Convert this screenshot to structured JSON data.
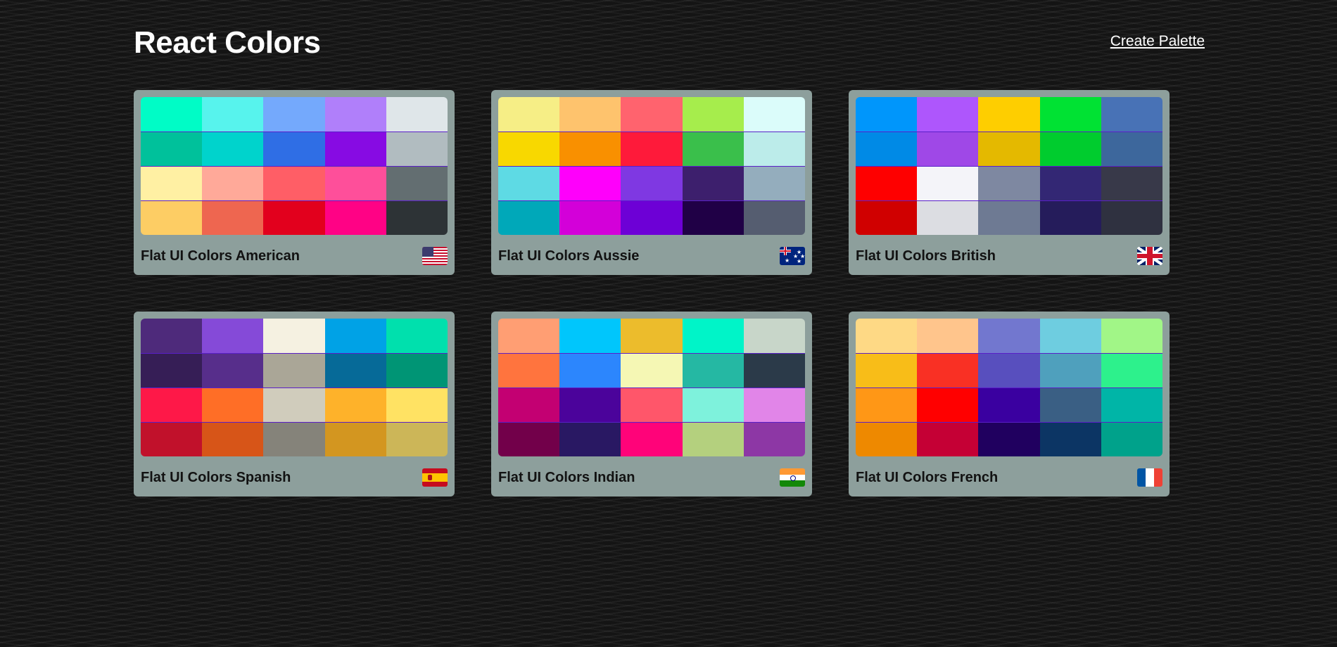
{
  "app": {
    "title": "React Colors",
    "create_link": "Create Palette"
  },
  "palettes": [
    {
      "name": "Flat UI Colors American",
      "flag": "us-flag-icon",
      "colors": [
        "#00fcc6",
        "#57f3ed",
        "#74a9fc",
        "#b07ffa",
        "#dfe6e9",
        "#00c19b",
        "#00d3cc",
        "#2f6ee5",
        "#870be3",
        "#b1bcc0",
        "#fff0a3",
        "#ffa999",
        "#ff5e66",
        "#fe4f9a",
        "#636e71",
        "#fdcd64",
        "#ee6650",
        "#e2001d",
        "#ff0285",
        "#2d3336"
      ]
    },
    {
      "name": "Flat UI Colors Aussie",
      "flag": "au-flag-icon",
      "colors": [
        "#f6ee86",
        "#fec36d",
        "#ff636e",
        "#a6ed4c",
        "#dbfcfa",
        "#f8d800",
        "#f99000",
        "#fe1a3a",
        "#3abf4b",
        "#bcecea",
        "#5edae4",
        "#fe00fb",
        "#7f38e2",
        "#3d1f6d",
        "#94adbd",
        "#00a8b9",
        "#d300d9",
        "#6d00d6",
        "#200046",
        "#555d70"
      ]
    },
    {
      "name": "Flat UI Colors British",
      "flag": "uk-flag-icon",
      "colors": [
        "#0096fb",
        "#ae56fc",
        "#fece00",
        "#00e233",
        "#4872b6",
        "#008ae6",
        "#9f48e7",
        "#e4b900",
        "#00cc2e",
        "#3d679c",
        "#fe0000",
        "#f4f4f9",
        "#7e88a1",
        "#332774",
        "#383949",
        "#d00000",
        "#dcdde2",
        "#6e7a93",
        "#251c5b",
        "#2f3140"
      ]
    },
    {
      "name": "Flat UI Colors Spanish",
      "flag": "es-flag-icon",
      "colors": [
        "#4e2a7b",
        "#854ad8",
        "#f5f1e1",
        "#00a2e6",
        "#00e0ad",
        "#361e56",
        "#572e8b",
        "#aaa697",
        "#066a98",
        "#009575",
        "#fe1848",
        "#ff6e26",
        "#d0ccbc",
        "#feb22a",
        "#ffe263",
        "#c1112b",
        "#d75518",
        "#85837a",
        "#d39620",
        "#ccb658"
      ]
    },
    {
      "name": "Flat UI Colors Indian",
      "flag": "in-flag-icon",
      "colors": [
        "#ff9e73",
        "#00c6fc",
        "#ecbc2c",
        "#00f4c8",
        "#c8d6c9",
        "#ff743e",
        "#2c86fd",
        "#f5f7b4",
        "#25b8a3",
        "#2b3a49",
        "#c30072",
        "#4b039b",
        "#ff566a",
        "#7ef2dc",
        "#e185e8",
        "#72004a",
        "#291863",
        "#ff0379",
        "#b4d07e",
        "#8d37a5"
      ]
    },
    {
      "name": "Flat UI Colors French",
      "flag": "fr-flag-icon",
      "colors": [
        "#fed985",
        "#ffc58c",
        "#7277cf",
        "#6ecde0",
        "#a1f687",
        "#f8bd18",
        "#f93024",
        "#584fbe",
        "#4fa0bd",
        "#2df18c",
        "#ff9716",
        "#ff0000",
        "#3a00a0",
        "#3a5f84",
        "#00b5a7",
        "#ee8900",
        "#c50035",
        "#20005f",
        "#0c3564",
        "#00a28b"
      ]
    }
  ]
}
